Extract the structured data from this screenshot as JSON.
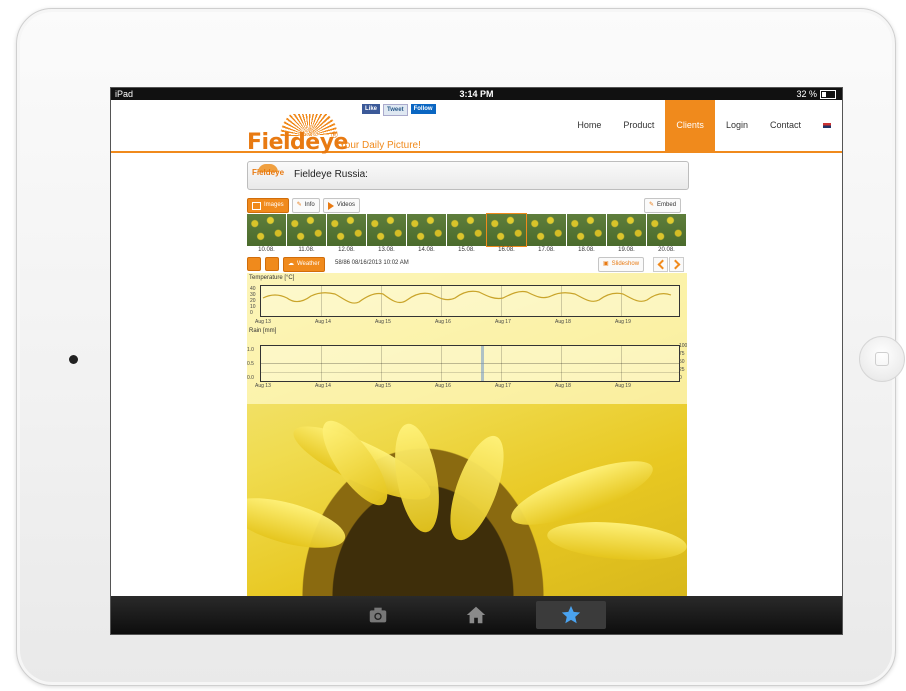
{
  "statusbar": {
    "device": "iPad",
    "time": "3:14 PM",
    "battery": "32 %"
  },
  "brand": {
    "name": "Fieldeye",
    "reg": "®",
    "tagline": "Your Daily Picture!"
  },
  "social": {
    "like": "Like",
    "tweet": "Tweet",
    "follow": "Follow"
  },
  "nav": {
    "items": [
      "Home",
      "Product",
      "Clients",
      "Login",
      "Contact"
    ],
    "active": "Clients"
  },
  "page": {
    "title": "Fieldeye Russia:",
    "mini_logo": "Fieldeye"
  },
  "tabs": {
    "images": "Images",
    "info": "Info",
    "videos": "Videos",
    "embed": "Embed"
  },
  "thumbnails": {
    "dates": [
      "10.08.",
      "11.08.",
      "12.08.",
      "13.08.",
      "14.08.",
      "15.08.",
      "16.08.",
      "17.08.",
      "18.08.",
      "19.08.",
      "20.08."
    ],
    "selected_index": 6
  },
  "viewer": {
    "weather": "Weather",
    "status": "58/86 08/16/2013 10:02 AM",
    "slideshow": "Slideshow"
  },
  "temperature_chart": {
    "label": "Temperature [°C]",
    "y_ticks": [
      "40",
      "30",
      "20",
      "10",
      "0"
    ],
    "x_ticks": [
      "Aug 13",
      "Aug 14",
      "Aug 15",
      "Aug 16",
      "Aug 17",
      "Aug 18",
      "Aug 19"
    ]
  },
  "rain_chart": {
    "label": "Rain [mm]",
    "y_ticks": [
      "1.0",
      "0.5",
      "0.0"
    ],
    "y2_ticks": [
      "100",
      "75",
      "50",
      "25",
      "0"
    ],
    "x_ticks": [
      "Aug 13",
      "Aug 14",
      "Aug 15",
      "Aug 16",
      "Aug 17",
      "Aug 18",
      "Aug 19"
    ]
  },
  "tabbar": {
    "items": [
      "camera-icon",
      "home-icon",
      "star-icon"
    ],
    "selected": "star-icon"
  },
  "colors": {
    "accent": "#f08a1c",
    "tempLine": "#c9a42a"
  }
}
